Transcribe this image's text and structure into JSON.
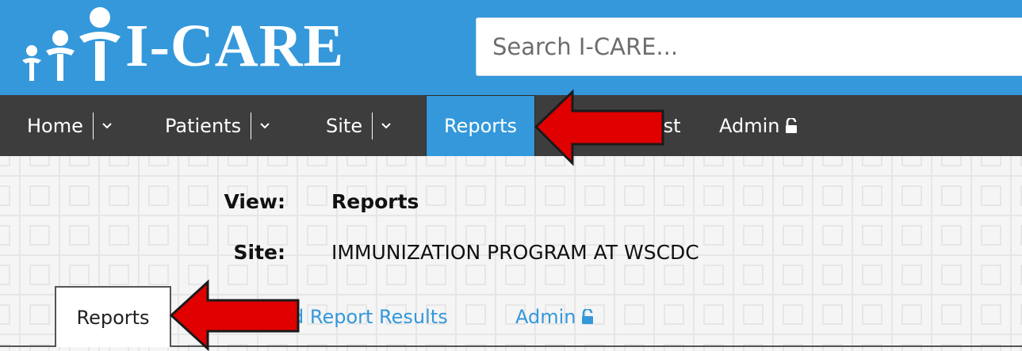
{
  "app": {
    "name": "I-CARE"
  },
  "search": {
    "placeholder": "Search I-CARE..."
  },
  "nav": {
    "items": [
      {
        "label": "Home"
      },
      {
        "label": "Patients"
      },
      {
        "label": "Site"
      },
      {
        "label": "Reports"
      },
      {
        "label": "ist"
      },
      {
        "label": "Admin"
      }
    ]
  },
  "page": {
    "view_label": "View:",
    "view_value": "Reports",
    "site_label": "Site:",
    "site_value": "IMMUNIZATION PROGRAM AT WSCDC"
  },
  "tabs": {
    "items": [
      {
        "label": "Reports"
      },
      {
        "label": "d Report Results"
      },
      {
        "label": "Admin"
      }
    ]
  },
  "colors": {
    "brand_blue": "#3498db",
    "nav_dark": "#3d3d3d",
    "annotation_red": "#e00000"
  },
  "icons": [
    "people-logo-icon",
    "chevron-down-icon",
    "lock-open-icon",
    "red-arrow-annotation"
  ]
}
